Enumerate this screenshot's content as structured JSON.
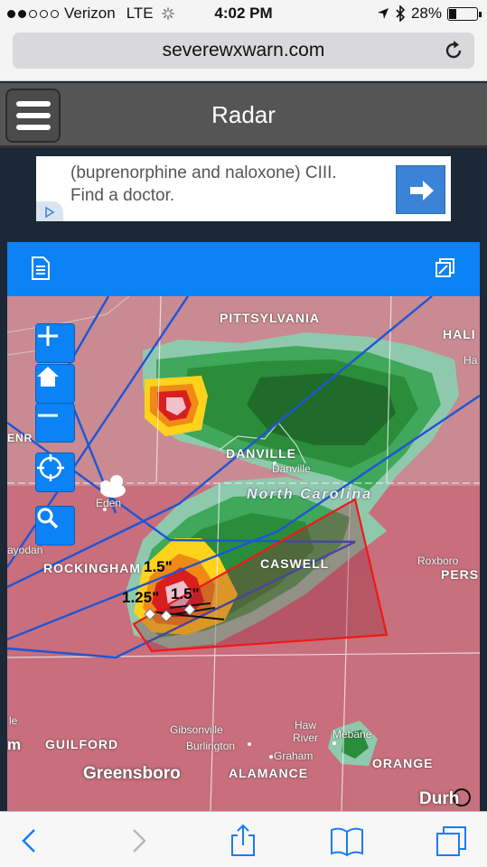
{
  "status_bar": {
    "carrier": "Verizon",
    "network": "LTE",
    "time": "4:02 PM",
    "battery": "28%",
    "battery_level": 0.28,
    "signal_bars": 2
  },
  "browser": {
    "url": "severewxwarn.com",
    "reload_icon": "reload-icon"
  },
  "header": {
    "title": "Radar",
    "menu_icon": "hamburger-menu-icon"
  },
  "ad": {
    "line1": "(buprenorphine and naloxone) CIII.",
    "line2": "Find a doctor.",
    "button_icon": "arrow-right-icon"
  },
  "panel": {
    "left_icon": "document-icon",
    "right_icon": "layers-icon"
  },
  "map": {
    "controls": [
      "zoom-in-icon",
      "home-icon",
      "zoom-out-icon",
      "locate-icon",
      "search-icon"
    ],
    "labels": {
      "pittsylvania": "PITTSYLVANIA",
      "hali": "HALI",
      "ha": "Ha",
      "enr": "ENR",
      "danville_county": "DANVILLE",
      "danville_town": "Danville",
      "eden": "Eden",
      "north_carolina": "North Carolina",
      "ayodan": "ayodan",
      "rockingham": "ROCKINGHAM",
      "caswell": "CASWELL",
      "roxboro": "Roxboro",
      "pers": "PERS",
      "hail1": "1.5\"",
      "hail2": "1.25\"",
      "hail3": "1.5\"",
      "le": "le",
      "m": "m",
      "guilford": "GUILFORD",
      "gibsonville": "Gibsonville",
      "burlington": "Burlington",
      "haw_river": "Haw River",
      "graham": "Graham",
      "mebane": "Mebane",
      "greensboro": "Greensboro",
      "alamance": "ALAMANCE",
      "orange": "ORANGE",
      "durham": "Durh"
    }
  },
  "toolbar": {
    "back": "back-icon",
    "forward": "forward-icon",
    "share": "share-icon",
    "bookmarks": "bookmarks-icon",
    "tabs": "tabs-icon"
  },
  "colors": {
    "accent_blue": "#0b82f5",
    "header_gray": "#555555",
    "map_base": "#c86e7c",
    "ios_blue": "#1a7cf5"
  }
}
